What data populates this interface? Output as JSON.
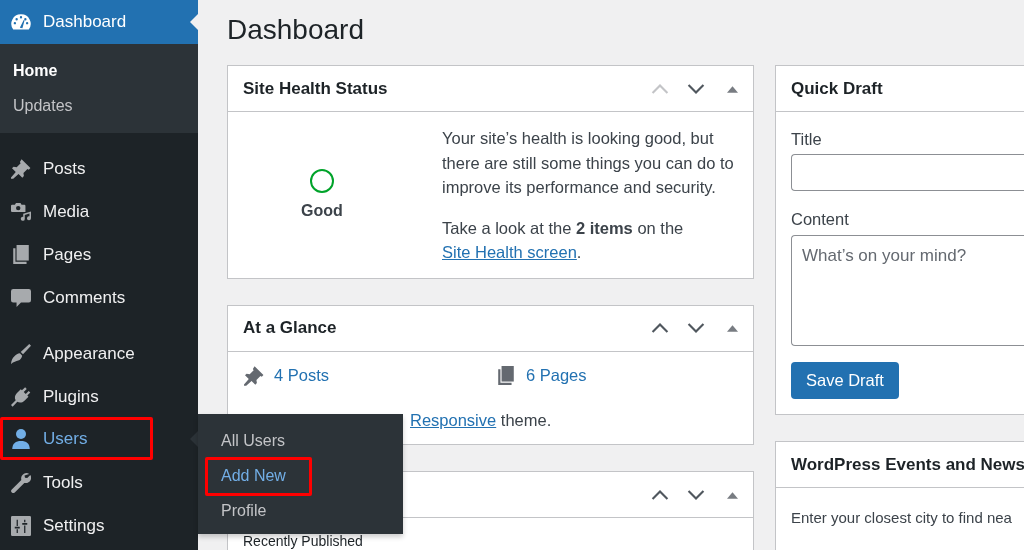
{
  "sidebar": {
    "menu_groups": [
      {
        "items": [
          {
            "kind": "dashboard",
            "label": "Dashboard",
            "selected": true,
            "hovered": false,
            "highlighted": false,
            "submenu": [
              {
                "label": "Home",
                "selected": true,
                "hovered": false,
                "highlighted": false
              },
              {
                "label": "Updates",
                "selected": false,
                "hovered": false,
                "highlighted": false
              }
            ]
          }
        ]
      },
      {
        "items": [
          {
            "kind": "posts",
            "label": "Posts",
            "selected": false,
            "hovered": false,
            "highlighted": false
          },
          {
            "kind": "media",
            "label": "Media",
            "selected": false,
            "hovered": false,
            "highlighted": false
          },
          {
            "kind": "pages",
            "label": "Pages",
            "selected": false,
            "hovered": false,
            "highlighted": false
          },
          {
            "kind": "comments",
            "label": "Comments",
            "selected": false,
            "hovered": false,
            "highlighted": false
          }
        ]
      },
      {
        "items": [
          {
            "kind": "appearance",
            "label": "Appearance",
            "selected": false,
            "hovered": false,
            "highlighted": false
          },
          {
            "kind": "plugins",
            "label": "Plugins",
            "selected": false,
            "hovered": false,
            "highlighted": false
          },
          {
            "kind": "users",
            "label": "Users",
            "selected": false,
            "hovered": true,
            "highlighted": true,
            "submenu": [
              {
                "label": "All Users",
                "selected": false,
                "hovered": false,
                "highlighted": false
              },
              {
                "label": "Add New",
                "selected": false,
                "hovered": true,
                "highlighted": true
              },
              {
                "label": "Profile",
                "selected": false,
                "hovered": false,
                "highlighted": false
              }
            ]
          },
          {
            "kind": "tools",
            "label": "Tools",
            "selected": false,
            "hovered": false,
            "highlighted": false
          },
          {
            "kind": "settings",
            "label": "Settings",
            "selected": false,
            "hovered": false,
            "highlighted": false
          }
        ]
      }
    ]
  },
  "page_title": "Dashboard",
  "columns": [
    {
      "cards": [
        {
          "kind": "site_health",
          "title": "Site Health Status",
          "controls": {
            "up_disabled": true,
            "down_disabled": false
          },
          "status_label": "Good",
          "summary": "Your site’s health is looking good, but there are still some things you can do to improve its performance and security.",
          "details": {
            "text": "Take a look at the **2 items** on the",
            "link": "Site Health screen",
            "after": "."
          }
        },
        {
          "kind": "at_a_glance",
          "title": "At a Glance",
          "controls": {
            "up_disabled": false,
            "down_disabled": false
          },
          "counts": [
            {
              "kind": "posts",
              "label": "4 Posts"
            },
            {
              "kind": "pages",
              "label": "6 Pages"
            }
          ],
          "theme_note": {
            "link": "Responsive",
            "after": "theme."
          }
        },
        {
          "kind": "activity",
          "controls": {
            "up_disabled": false,
            "down_disabled": false
          },
          "section_title": "Recently Published"
        }
      ]
    },
    {
      "cards": [
        {
          "kind": "quick_draft",
          "title": "Quick Draft",
          "fields": [
            {
              "kind": "input",
              "label": "Title"
            },
            {
              "kind": "textarea",
              "label": "Content",
              "placeholder": "What’s on your mind?"
            }
          ],
          "button": "Save Draft"
        },
        {
          "kind": "events",
          "title": "WordPress Events and News",
          "intro": "Enter your closest city to find nea"
        }
      ]
    }
  ]
}
